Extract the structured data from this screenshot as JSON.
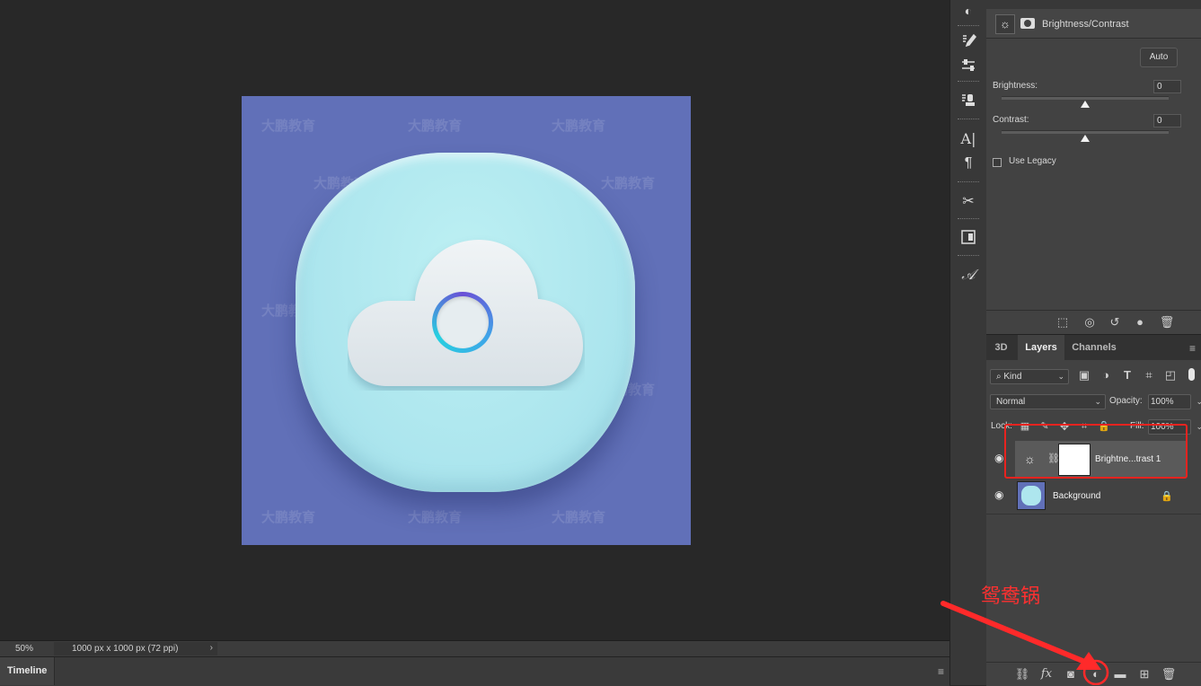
{
  "canvas": {
    "watermark_text": "大鹏教育",
    "status": {
      "zoom": "50%",
      "doc_info": "1000 px x 1000 px (72 ppi)",
      "arrow": "›"
    }
  },
  "timeline": {
    "label": "Timeline"
  },
  "properties": {
    "title": "Brightness/Contrast",
    "auto_label": "Auto",
    "brightness_label": "Brightness:",
    "brightness_value": "0",
    "contrast_label": "Contrast:",
    "contrast_value": "0",
    "use_legacy_label": "Use Legacy",
    "use_legacy_checked": false
  },
  "layers_panel": {
    "tabs": [
      "3D",
      "Layers",
      "Channels"
    ],
    "active_tab": "Layers",
    "filter_kind": "Kind",
    "blend_mode": "Normal",
    "opacity_label": "Opacity:",
    "opacity_value": "100%",
    "lock_label": "Lock:",
    "fill_label": "Fill:",
    "fill_value": "100%",
    "layers": [
      {
        "name": "Brightne...trast 1",
        "type": "adjustment",
        "visible": true,
        "selected": true
      },
      {
        "name": "Background",
        "type": "image",
        "visible": true,
        "locked": true
      }
    ]
  },
  "annotation": {
    "text": "鸳鸯锅",
    "color": "#ff2a2a"
  },
  "colors": {
    "artboard": "#6170b8",
    "icon_bg": "#aee6ee",
    "highlight": "#e8231f"
  }
}
